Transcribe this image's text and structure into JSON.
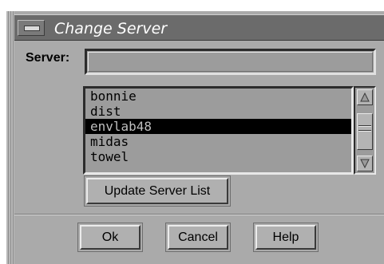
{
  "window": {
    "title": "Change Server"
  },
  "server": {
    "label": "Server:",
    "value": ""
  },
  "list": {
    "items": [
      "bonnie",
      "dist",
      "envlab48",
      "midas",
      "towel"
    ],
    "selected_index": 2
  },
  "buttons": {
    "update": "Update Server List",
    "ok": "Ok",
    "cancel": "Cancel",
    "help": "Help"
  },
  "icons": {
    "window_menu": "window-menu-icon",
    "scroll_up": "up-arrow-icon",
    "scroll_down": "down-arrow-icon"
  }
}
